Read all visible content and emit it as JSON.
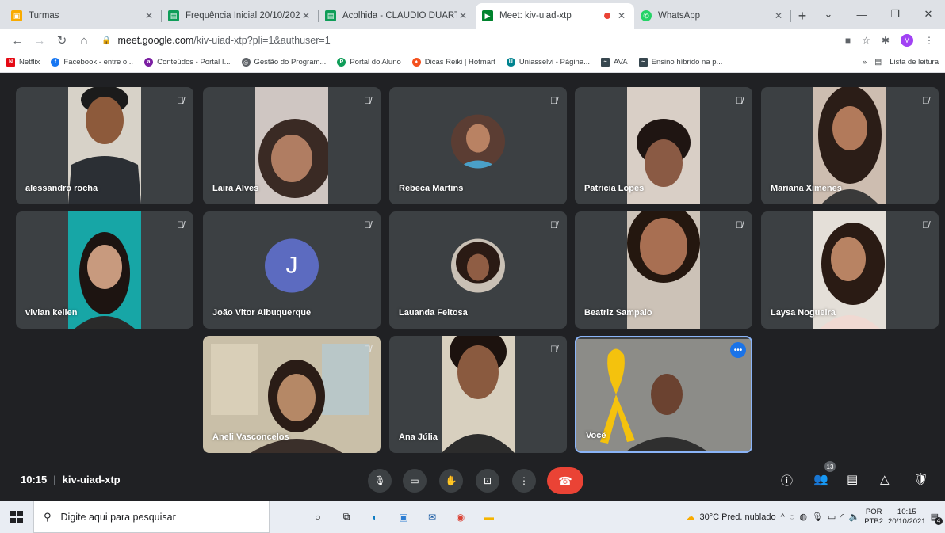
{
  "browser": {
    "tabs": [
      {
        "title": "Turmas",
        "icon": "classroom-icon",
        "color": "#f9ab00"
      },
      {
        "title": "Frequência Inicial 20/10/202",
        "icon": "sheets-icon",
        "color": "#0f9d58"
      },
      {
        "title": "Acolhida - CLÁUDIO DUARTE",
        "icon": "sheets-icon",
        "color": "#0f9d58"
      },
      {
        "title": "Meet: kiv-uiad-xtp",
        "icon": "meet-icon",
        "color": "#00832d",
        "active": true
      },
      {
        "title": "",
        "icon": "recording-dot-icon",
        "color": "#ea4335"
      },
      {
        "title": "WhatsApp",
        "icon": "whatsapp-icon",
        "color": "#25d366"
      }
    ],
    "url_host": "meet.google.com",
    "url_rest": "/kiv-uiad-xtp?pli=1&authuser=1",
    "profile_initial": "M",
    "bookmarks": [
      {
        "label": "Netflix",
        "color": "#e50914"
      },
      {
        "label": "Facebook - entre o...",
        "color": "#1877f2"
      },
      {
        "label": "Conteúdos - Portal I...",
        "color": "#7b1fa2"
      },
      {
        "label": "Gestão do Program...",
        "color": "#5f6368"
      },
      {
        "label": "Portal do Aluno",
        "color": "#0f9d58"
      },
      {
        "label": "Dicas Reiki | Hotmart",
        "color": "#f4511e"
      },
      {
        "label": "Uniasselvi - Página...",
        "color": "#00838f"
      },
      {
        "label": "AVA",
        "color": "#37474f"
      },
      {
        "label": "Ensino híbrido na p...",
        "color": "#37474f"
      }
    ],
    "bookmarks_more": "»",
    "reading_list": "Lista de leitura"
  },
  "participants": [
    {
      "name": "alessandro rocha",
      "kind": "video",
      "skin": "#8d5a3b",
      "bg": "#d7d2c8"
    },
    {
      "name": "Laira Alves",
      "kind": "video",
      "skin": "#b07d62",
      "bg": "#cfc6c2"
    },
    {
      "name": "Rebeca Martins",
      "kind": "avatar",
      "skin": "#b98263"
    },
    {
      "name": "Patricia Lopes",
      "kind": "video",
      "skin": "#8a5a44",
      "bg": "#d9cfc6"
    },
    {
      "name": "Mariana Ximenes",
      "kind": "video",
      "skin": "#b27a5b",
      "bg": "#cdbdb0"
    },
    {
      "name": "vivian kellen",
      "kind": "video",
      "skin": "#c89a7e",
      "bg": "#17a6a6"
    },
    {
      "name": "João Vitor Albuquerque",
      "kind": "letter",
      "letter": "J"
    },
    {
      "name": "Lauanda Feitosa",
      "kind": "avatar",
      "skin": "#8f5d44"
    },
    {
      "name": "Beatriz Sampaio",
      "kind": "video",
      "skin": "#a86f52",
      "bg": "#ccc2b7"
    },
    {
      "name": "Laysa Nogueira",
      "kind": "video",
      "skin": "#b88363",
      "bg": "#e4dfd8"
    },
    {
      "name": "Aneli Vasconcelos",
      "kind": "video",
      "skin": "#b58866",
      "bg": "#c9bfa8"
    },
    {
      "name": "Ana Júlia",
      "kind": "video",
      "skin": "#8a5a3f",
      "bg": "#d8d0bf"
    },
    {
      "name": "Você",
      "kind": "self",
      "skin": "#6b4230",
      "bg": "#8c8c88"
    }
  ],
  "meeting": {
    "time": "10:15",
    "code": "kiv-uiad-xtp",
    "participant_count": "13"
  },
  "taskbar": {
    "search_placeholder": "Digite aqui para pesquisar",
    "weather": "30°C  Pred. nublado",
    "lang_top": "POR",
    "lang_bottom": "PTB2",
    "clock_time": "10:15",
    "clock_date": "20/10/2021",
    "notification_count": "4"
  }
}
